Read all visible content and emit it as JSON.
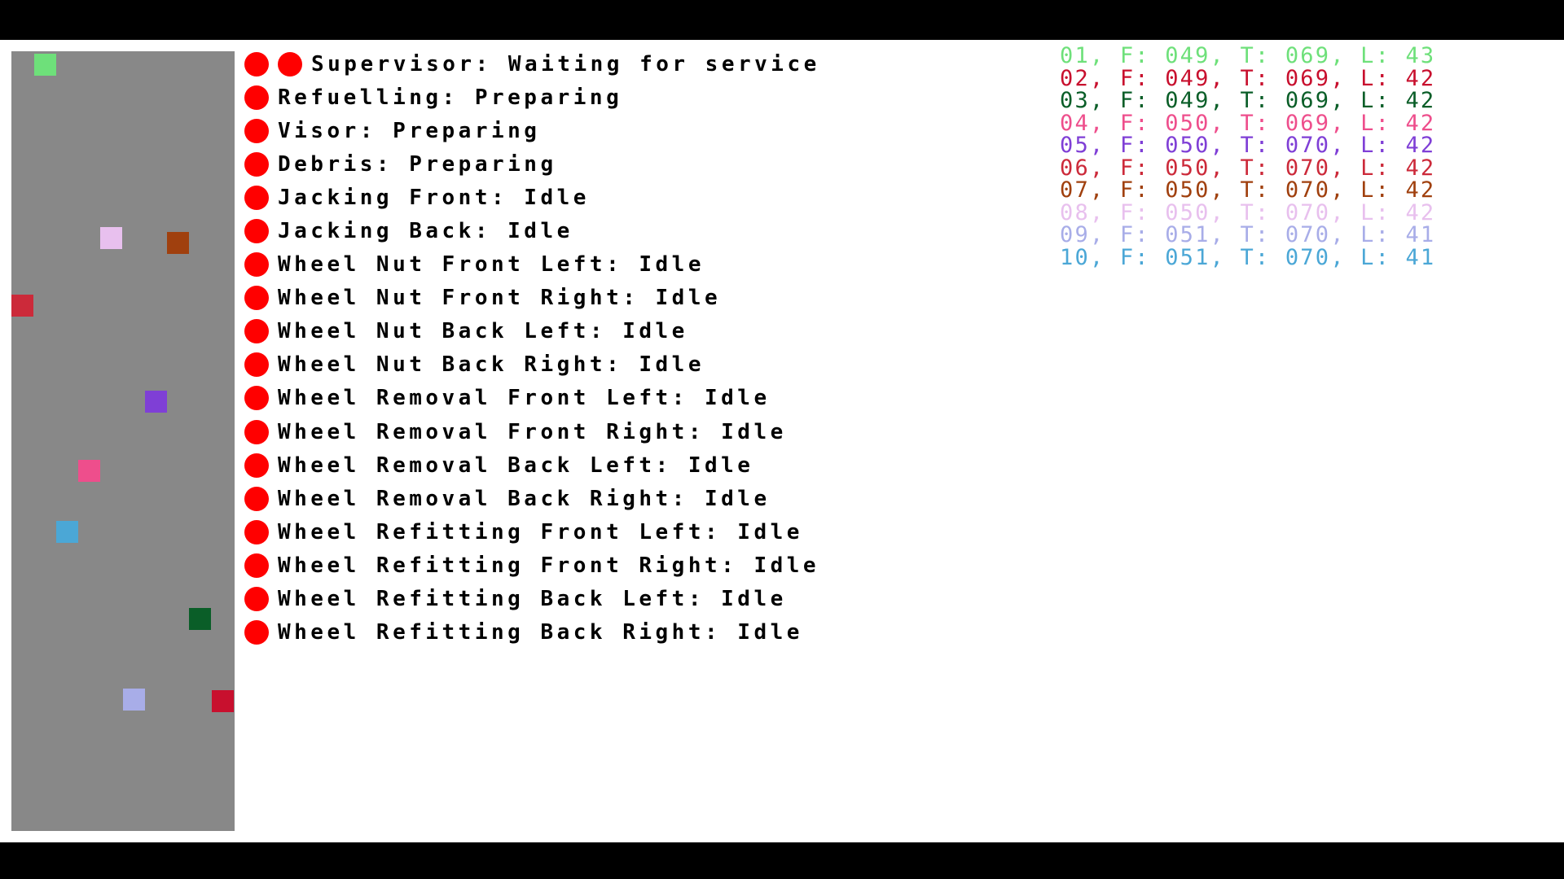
{
  "track": {
    "background": "#888888",
    "cars": [
      {
        "color": "#6ee07a"
      },
      {
        "color": "#e8c0ee"
      },
      {
        "color": "#a0400e"
      },
      {
        "color": "#cc2a3a"
      },
      {
        "color": "#7f3fd6"
      },
      {
        "color": "#ee4e8c"
      },
      {
        "color": "#4ba7d6"
      },
      {
        "color": "#0a5e28"
      },
      {
        "color": "#a8ade8"
      },
      {
        "color": "#c8102e"
      }
    ]
  },
  "status": {
    "indicator_color": "#ff0000",
    "items": [
      {
        "text": "Supervisor: Waiting for service",
        "dots": 2
      },
      {
        "text": "Refuelling: Preparing",
        "dots": 1
      },
      {
        "text": "Visor: Preparing",
        "dots": 1
      },
      {
        "text": "Debris: Preparing",
        "dots": 1
      },
      {
        "text": "Jacking Front: Idle",
        "dots": 1
      },
      {
        "text": "Jacking Back: Idle",
        "dots": 1
      },
      {
        "text": "Wheel Nut Front Left: Idle",
        "dots": 1
      },
      {
        "text": "Wheel Nut Front Right: Idle",
        "dots": 1
      },
      {
        "text": "Wheel Nut Back Left: Idle",
        "dots": 1
      },
      {
        "text": "Wheel Nut Back Right: Idle",
        "dots": 1
      },
      {
        "text": "Wheel Removal Front Left: Idle",
        "dots": 1
      },
      {
        "text": "Wheel Removal Front Right: Idle",
        "dots": 1
      },
      {
        "text": "Wheel Removal Back Left: Idle",
        "dots": 1
      },
      {
        "text": "Wheel Removal Back Right: Idle",
        "dots": 1
      },
      {
        "text": "Wheel Refitting Front Left: Idle",
        "dots": 1
      },
      {
        "text": "Wheel Refitting Front Right: Idle",
        "dots": 1
      },
      {
        "text": "Wheel Refitting Back Left: Idle",
        "dots": 1
      },
      {
        "text": "Wheel Refitting Back Right: Idle",
        "dots": 1
      }
    ]
  },
  "leaderboard": {
    "rows": [
      {
        "text": "01, F: 049, T: 069, L: 43",
        "color": "#6ee07a"
      },
      {
        "text": "02, F: 049, T: 069, L: 42",
        "color": "#c8102e"
      },
      {
        "text": "03, F: 049, T: 069, L: 42",
        "color": "#0a5e28"
      },
      {
        "text": "04, F: 050, T: 069, L: 42",
        "color": "#ee4e8c"
      },
      {
        "text": "05, F: 050, T: 070, L: 42",
        "color": "#7f3fd6"
      },
      {
        "text": "06, F: 050, T: 070, L: 42",
        "color": "#cc2a3a"
      },
      {
        "text": "07, F: 050, T: 070, L: 42",
        "color": "#a0400e"
      },
      {
        "text": "08, F: 050, T: 070, L: 42",
        "color": "#e8c0ee"
      },
      {
        "text": "09, F: 051, T: 070, L: 41",
        "color": "#a8ade8"
      },
      {
        "text": "10, F: 051, T: 070, L: 41",
        "color": "#4ba7d6"
      }
    ]
  }
}
